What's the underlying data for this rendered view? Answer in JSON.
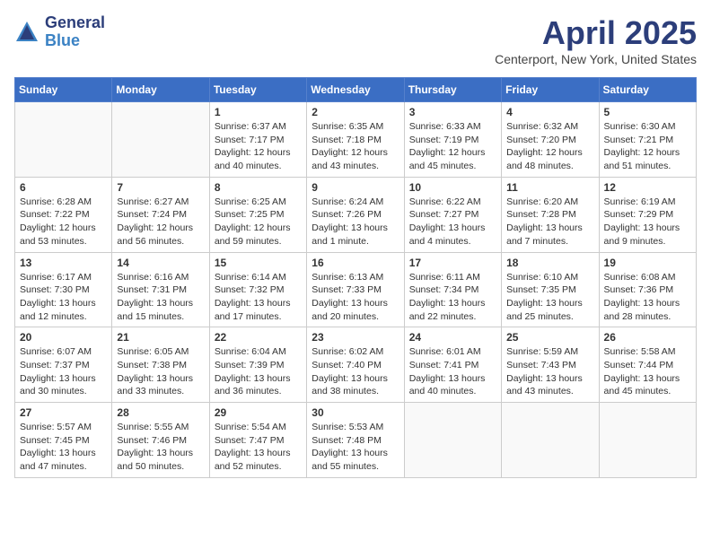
{
  "logo": {
    "general": "General",
    "blue": "Blue"
  },
  "title": "April 2025",
  "subtitle": "Centerport, New York, United States",
  "weekdays": [
    "Sunday",
    "Monday",
    "Tuesday",
    "Wednesday",
    "Thursday",
    "Friday",
    "Saturday"
  ],
  "weeks": [
    [
      {
        "day": "",
        "content": ""
      },
      {
        "day": "",
        "content": ""
      },
      {
        "day": "1",
        "content": "Sunrise: 6:37 AM\nSunset: 7:17 PM\nDaylight: 12 hours\nand 40 minutes."
      },
      {
        "day": "2",
        "content": "Sunrise: 6:35 AM\nSunset: 7:18 PM\nDaylight: 12 hours\nand 43 minutes."
      },
      {
        "day": "3",
        "content": "Sunrise: 6:33 AM\nSunset: 7:19 PM\nDaylight: 12 hours\nand 45 minutes."
      },
      {
        "day": "4",
        "content": "Sunrise: 6:32 AM\nSunset: 7:20 PM\nDaylight: 12 hours\nand 48 minutes."
      },
      {
        "day": "5",
        "content": "Sunrise: 6:30 AM\nSunset: 7:21 PM\nDaylight: 12 hours\nand 51 minutes."
      }
    ],
    [
      {
        "day": "6",
        "content": "Sunrise: 6:28 AM\nSunset: 7:22 PM\nDaylight: 12 hours\nand 53 minutes."
      },
      {
        "day": "7",
        "content": "Sunrise: 6:27 AM\nSunset: 7:24 PM\nDaylight: 12 hours\nand 56 minutes."
      },
      {
        "day": "8",
        "content": "Sunrise: 6:25 AM\nSunset: 7:25 PM\nDaylight: 12 hours\nand 59 minutes."
      },
      {
        "day": "9",
        "content": "Sunrise: 6:24 AM\nSunset: 7:26 PM\nDaylight: 13 hours\nand 1 minute."
      },
      {
        "day": "10",
        "content": "Sunrise: 6:22 AM\nSunset: 7:27 PM\nDaylight: 13 hours\nand 4 minutes."
      },
      {
        "day": "11",
        "content": "Sunrise: 6:20 AM\nSunset: 7:28 PM\nDaylight: 13 hours\nand 7 minutes."
      },
      {
        "day": "12",
        "content": "Sunrise: 6:19 AM\nSunset: 7:29 PM\nDaylight: 13 hours\nand 9 minutes."
      }
    ],
    [
      {
        "day": "13",
        "content": "Sunrise: 6:17 AM\nSunset: 7:30 PM\nDaylight: 13 hours\nand 12 minutes."
      },
      {
        "day": "14",
        "content": "Sunrise: 6:16 AM\nSunset: 7:31 PM\nDaylight: 13 hours\nand 15 minutes."
      },
      {
        "day": "15",
        "content": "Sunrise: 6:14 AM\nSunset: 7:32 PM\nDaylight: 13 hours\nand 17 minutes."
      },
      {
        "day": "16",
        "content": "Sunrise: 6:13 AM\nSunset: 7:33 PM\nDaylight: 13 hours\nand 20 minutes."
      },
      {
        "day": "17",
        "content": "Sunrise: 6:11 AM\nSunset: 7:34 PM\nDaylight: 13 hours\nand 22 minutes."
      },
      {
        "day": "18",
        "content": "Sunrise: 6:10 AM\nSunset: 7:35 PM\nDaylight: 13 hours\nand 25 minutes."
      },
      {
        "day": "19",
        "content": "Sunrise: 6:08 AM\nSunset: 7:36 PM\nDaylight: 13 hours\nand 28 minutes."
      }
    ],
    [
      {
        "day": "20",
        "content": "Sunrise: 6:07 AM\nSunset: 7:37 PM\nDaylight: 13 hours\nand 30 minutes."
      },
      {
        "day": "21",
        "content": "Sunrise: 6:05 AM\nSunset: 7:38 PM\nDaylight: 13 hours\nand 33 minutes."
      },
      {
        "day": "22",
        "content": "Sunrise: 6:04 AM\nSunset: 7:39 PM\nDaylight: 13 hours\nand 36 minutes."
      },
      {
        "day": "23",
        "content": "Sunrise: 6:02 AM\nSunset: 7:40 PM\nDaylight: 13 hours\nand 38 minutes."
      },
      {
        "day": "24",
        "content": "Sunrise: 6:01 AM\nSunset: 7:41 PM\nDaylight: 13 hours\nand 40 minutes."
      },
      {
        "day": "25",
        "content": "Sunrise: 5:59 AM\nSunset: 7:43 PM\nDaylight: 13 hours\nand 43 minutes."
      },
      {
        "day": "26",
        "content": "Sunrise: 5:58 AM\nSunset: 7:44 PM\nDaylight: 13 hours\nand 45 minutes."
      }
    ],
    [
      {
        "day": "27",
        "content": "Sunrise: 5:57 AM\nSunset: 7:45 PM\nDaylight: 13 hours\nand 47 minutes."
      },
      {
        "day": "28",
        "content": "Sunrise: 5:55 AM\nSunset: 7:46 PM\nDaylight: 13 hours\nand 50 minutes."
      },
      {
        "day": "29",
        "content": "Sunrise: 5:54 AM\nSunset: 7:47 PM\nDaylight: 13 hours\nand 52 minutes."
      },
      {
        "day": "30",
        "content": "Sunrise: 5:53 AM\nSunset: 7:48 PM\nDaylight: 13 hours\nand 55 minutes."
      },
      {
        "day": "",
        "content": ""
      },
      {
        "day": "",
        "content": ""
      },
      {
        "day": "",
        "content": ""
      }
    ]
  ]
}
